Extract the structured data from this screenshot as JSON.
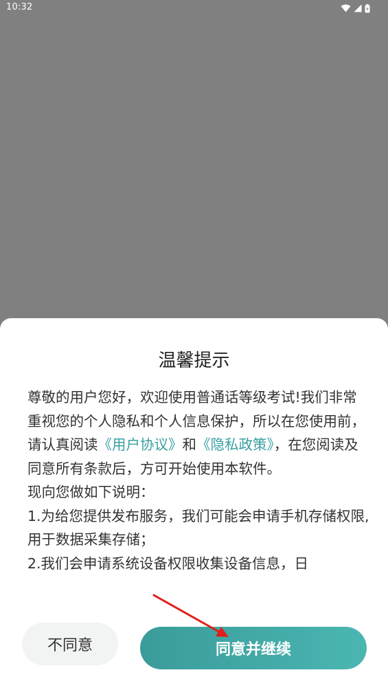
{
  "status_bar": {
    "time": "10:32",
    "icons": [
      "wifi-icon",
      "signal-icon",
      "battery-icon"
    ]
  },
  "dialog": {
    "title": "温馨提示",
    "paragraphs": [
      {
        "text_before": "尊敬的用户您好，欢迎使用普通话等级考试!我们非常重视您的个人隐私和个人信息保护，所以在您使用前，请认真阅读",
        "link_user_agreement": "《用户协议》",
        "text_and": "和",
        "link_privacy_policy": "《隐私政策》",
        "text_after": "，在您阅读及同意所有条款后，方可开始使用本软件。"
      },
      {
        "text": "现向您做如下说明："
      },
      {
        "text": "1.为给您提供发布服务，我们可能会申请手机存储权限, 用于数据采集存储；"
      },
      {
        "text": "2.我们会申请系统设备权限收集设备信息，日"
      }
    ],
    "buttons": {
      "disagree_label": "不同意",
      "agree_label": "同意并继续"
    }
  },
  "colors": {
    "overlay": "#808080",
    "link": "#3aa0a3",
    "agree_button": "#46aaa7",
    "disagree_button": "#f2f3f3",
    "annotation_arrow": "#e0201a"
  }
}
